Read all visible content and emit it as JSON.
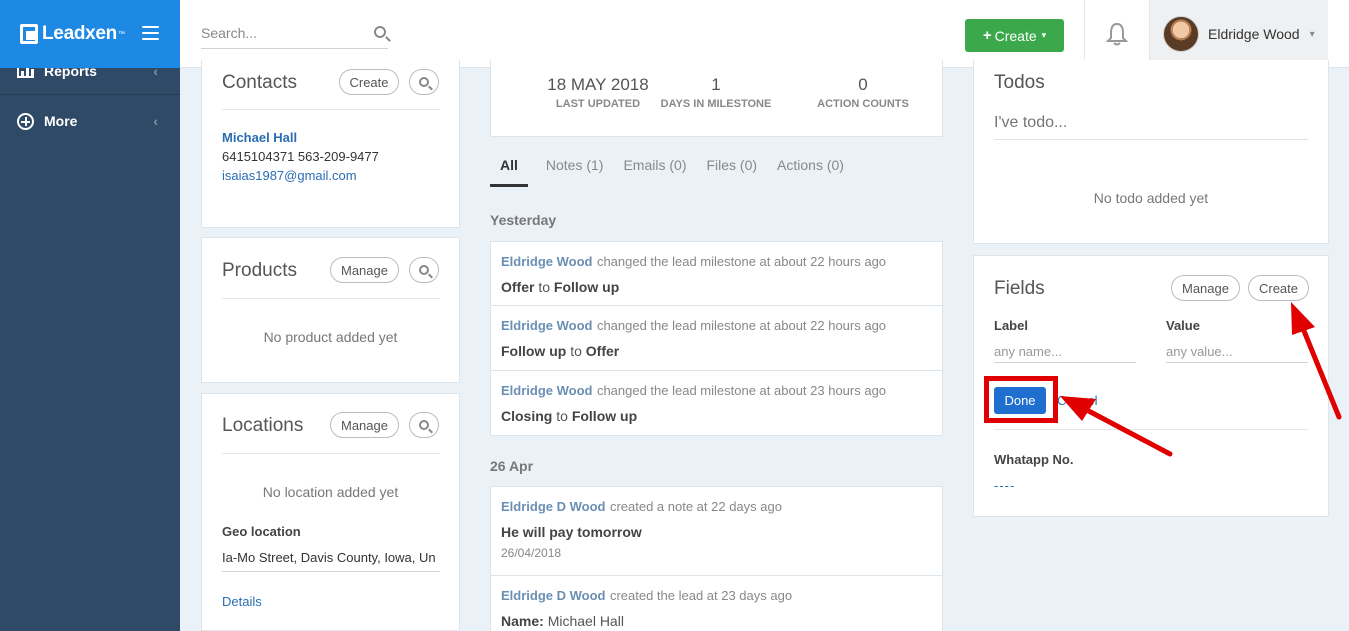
{
  "brand": {
    "name": "Leadxen",
    "tm": "™"
  },
  "sidebar": {
    "items": [
      {
        "label": "Reports",
        "icon": "bar-chart-icon"
      },
      {
        "label": "More",
        "icon": "plus-circle-icon"
      }
    ]
  },
  "header": {
    "search_placeholder": "Search...",
    "create_label": "Create",
    "user_name": "Eldridge Wood"
  },
  "contacts": {
    "title": "Contacts",
    "create_label": "Create",
    "name": "Michael Hall",
    "phones": "6415104371 563-209-9477",
    "email": "isaias1987@gmail.com"
  },
  "products": {
    "title": "Products",
    "manage_label": "Manage",
    "empty": "No product added yet"
  },
  "locations": {
    "title": "Locations",
    "manage_label": "Manage",
    "empty": "No location added yet",
    "geo_label": "Geo location",
    "geo_value": "Ia-Mo Street, Davis County, Iowa, Un",
    "details_link": "Details"
  },
  "stats": [
    {
      "value": "18 MAY 2018",
      "label": "LAST UPDATED"
    },
    {
      "value": "1",
      "label": "DAYS IN MILESTONE"
    },
    {
      "value": "0",
      "label": "ACTION COUNTS"
    }
  ],
  "tabs": [
    "All",
    "Notes (1)",
    "Emails (0)",
    "Files (0)",
    "Actions (0)"
  ],
  "feed": {
    "groups": [
      {
        "day": "Yesterday",
        "items": [
          {
            "who": "Eldridge Wood",
            "what": "changed the lead milestone at about 22 hours ago",
            "from": "Offer",
            "to": "Follow up"
          },
          {
            "who": "Eldridge Wood",
            "what": "changed the lead milestone at about 22 hours ago",
            "from": "Follow up",
            "to": "Offer"
          },
          {
            "who": "Eldridge Wood",
            "what": "changed the lead milestone at about 23 hours ago",
            "from": "Closing",
            "to": "Follow up"
          }
        ]
      },
      {
        "day": "26 Apr",
        "items": [
          {
            "who": "Eldridge D Wood",
            "what": "created a note at 22 days ago",
            "text": "He will pay tomorrow",
            "date": "26/04/2018"
          },
          {
            "who": "Eldridge D Wood",
            "what": "created the lead at 23 days ago",
            "name_label": "Name:",
            "name_value": "Michael Hall"
          }
        ]
      }
    ],
    "connector": "to"
  },
  "todos": {
    "title": "Todos",
    "placeholder": "I've todo...",
    "empty": "No todo added yet"
  },
  "fields": {
    "title": "Fields",
    "manage_label": "Manage",
    "create_label": "Create",
    "label_header": "Label",
    "value_header": "Value",
    "label_placeholder": "any name...",
    "value_placeholder": "any value...",
    "done_label": "Done",
    "cancel_label": "Cancel",
    "custom_field_name": "Whatapp No.",
    "custom_field_value": "----"
  },
  "colors": {
    "brand": "#1e88e5",
    "sidebar": "#2f4a66",
    "create_button": "#3aa84b",
    "done_button": "#1e6fd0",
    "annotation": "#e00000"
  }
}
